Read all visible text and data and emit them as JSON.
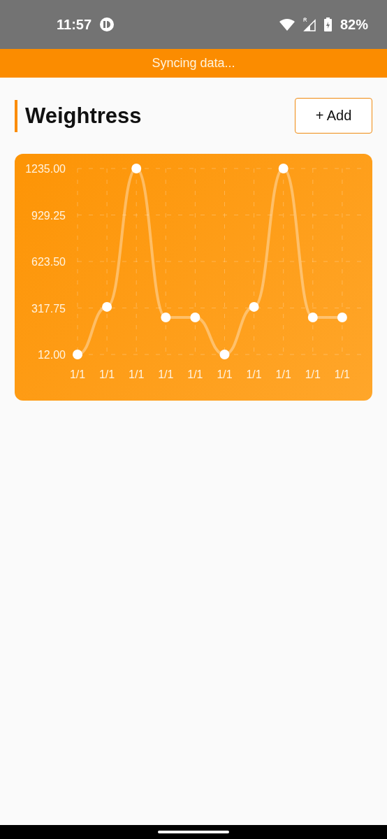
{
  "status_bar": {
    "time": "11:57",
    "battery": "82%"
  },
  "sync_banner": {
    "text": "Syncing data..."
  },
  "header": {
    "title": "Weightress",
    "add_button": "+ Add"
  },
  "chart": {
    "chart_data": {
      "type": "line",
      "categories": [
        "1/1",
        "1/1",
        "1/1",
        "1/1",
        "1/1",
        "1/1",
        "1/1",
        "1/1",
        "1/1",
        "1/1"
      ],
      "series": [
        {
          "color": "#ffffff",
          "marker": true,
          "values": [
            12,
            325,
            1235,
            256,
            256,
            12,
            325,
            1235,
            256,
            256
          ]
        }
      ],
      "grid": true,
      "ylim": [
        12,
        1235
      ],
      "yticks": [
        {
          "value": 12,
          "label": "12.00"
        },
        {
          "value": 317.75,
          "label": "317.75"
        },
        {
          "value": 623.5,
          "label": "623.50"
        },
        {
          "value": 929.25,
          "label": "929.25"
        },
        {
          "value": 1235,
          "label": "1235.00"
        }
      ]
    }
  }
}
